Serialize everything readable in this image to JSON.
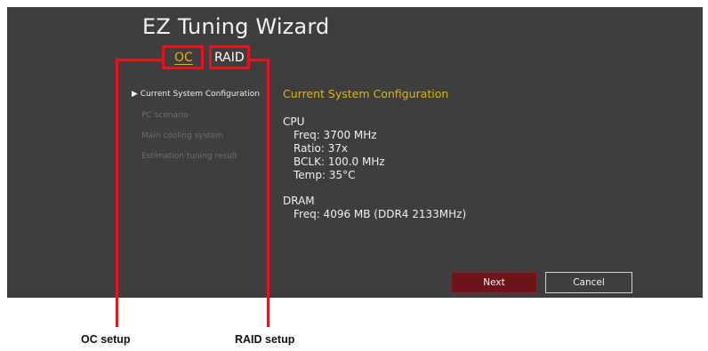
{
  "window": {
    "title": "EZ Tuning Wizard"
  },
  "tabs": [
    {
      "label": "OC",
      "selected": true
    },
    {
      "label": "RAID",
      "selected": false
    }
  ],
  "steps": [
    {
      "label": "Current System Configuration",
      "active": true,
      "marker": "▶"
    },
    {
      "label": "PC scenario",
      "active": false
    },
    {
      "label": "Main cooling system",
      "active": false
    },
    {
      "label": "Estimation tuning result",
      "active": false
    }
  ],
  "content": {
    "section_title": "Current System Configuration",
    "cpu": {
      "heading": "CPU",
      "freq": "Freq: 3700 MHz",
      "ratio": "Ratio: 37x",
      "bclk": "BCLK: 100.0 MHz",
      "temp": "Temp: 35°C"
    },
    "dram": {
      "heading": "DRAM",
      "freq": "Freq: 4096 MB (DDR4 2133MHz)"
    }
  },
  "buttons": {
    "next": "Next",
    "cancel": "Cancel"
  },
  "callouts": {
    "oc": "OC setup",
    "raid": "RAID setup"
  },
  "colors": {
    "panel_bg": "#3e3e3e",
    "accent": "#e1b400",
    "highlight": "#e8121c",
    "next_button": "#6e1519"
  }
}
